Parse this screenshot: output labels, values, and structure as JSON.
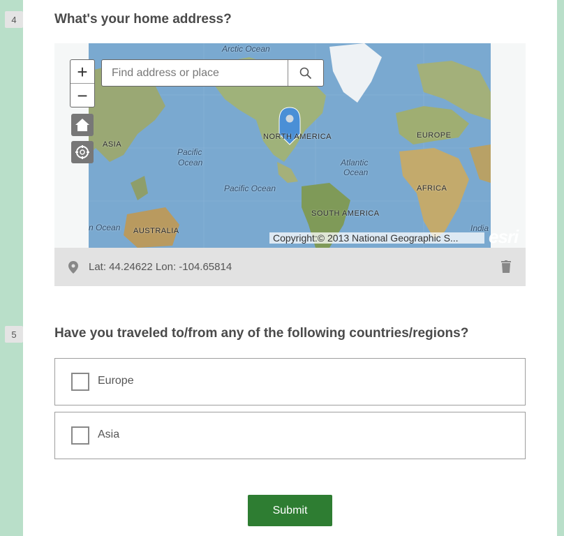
{
  "questions": [
    {
      "number": "4",
      "title": "What's your home address?"
    },
    {
      "number": "5",
      "title": "Have you traveled to/from any of the following countries/regions?"
    }
  ],
  "map": {
    "search_placeholder": "Find address or place",
    "zoom_in": "+",
    "zoom_out": "−",
    "labels": {
      "arctic": "Arctic Ocean",
      "asia": "ASIA",
      "pacific_left_1": "Pacific",
      "pacific_left_2": "Ocean",
      "north_america": "NORTH AMERICA",
      "europe": "EUROPE",
      "atlantic_1": "Atlantic",
      "atlantic_2": "Ocean",
      "pacific_center": "Pacific Ocean",
      "africa": "AFRICA",
      "south_america": "SOUTH AMERICA",
      "indian_left": "n Ocean",
      "australia": "AUSTRALIA",
      "india_right": "India"
    },
    "copyright": "Copyright:© 2013 National Geographic S...",
    "logo": "esri",
    "colors": {
      "ocean": "#7aa9d0",
      "land": "#9fb27a",
      "pin": "#4a8fd6"
    }
  },
  "location": {
    "text": "Lat: 44.24622 Lon: -104.65814"
  },
  "choices": [
    {
      "label": "Europe",
      "checked": false
    },
    {
      "label": "Asia",
      "checked": false
    }
  ],
  "submit_label": "Submit",
  "colors": {
    "page_bg": "#b9dfc9",
    "submit": "#2e7d32"
  }
}
